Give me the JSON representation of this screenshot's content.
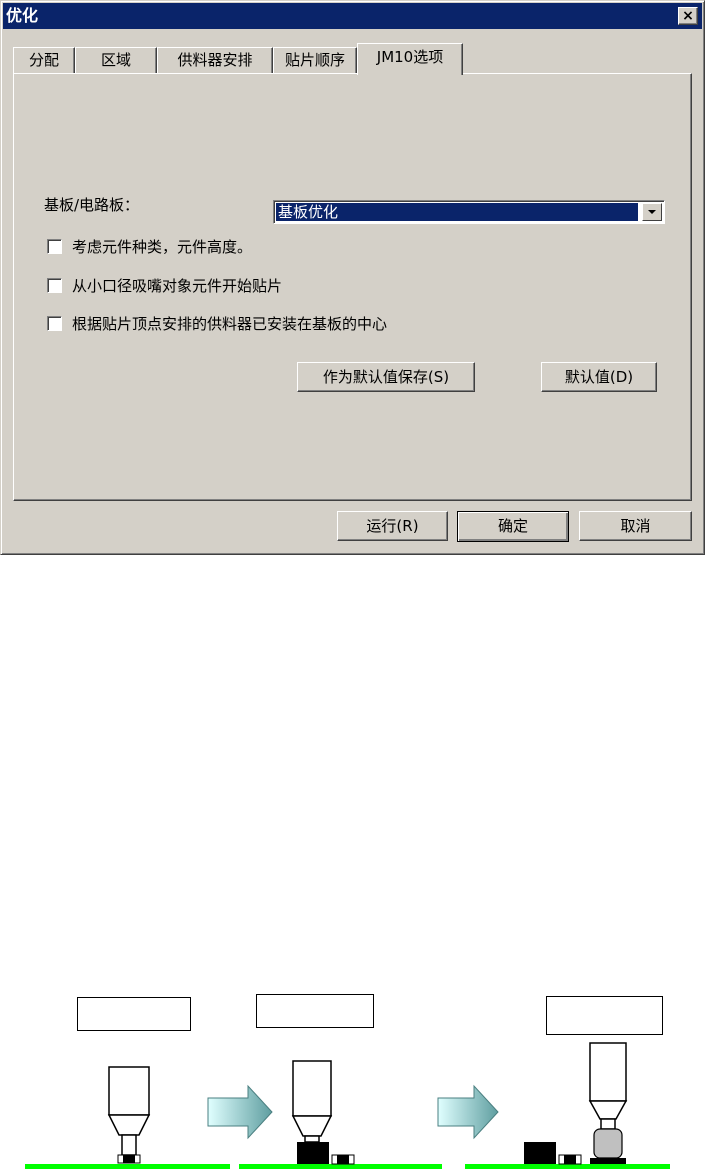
{
  "window": {
    "title": "优化",
    "close_label": "×"
  },
  "tabs": [
    {
      "label": "分配",
      "active": false
    },
    {
      "label": "区域",
      "active": false
    },
    {
      "label": "供料器安排",
      "active": false
    },
    {
      "label": "贴片顺序",
      "active": false
    },
    {
      "label": "JM10选项",
      "active": true
    }
  ],
  "panel": {
    "board_label": "基板/电路板：",
    "board_select": {
      "value": "基板优化"
    },
    "checkboxes": [
      {
        "label": "考虑元件种类，元件高度。",
        "checked": false
      },
      {
        "label": "从小口径吸嘴对象元件开始贴片",
        "checked": false
      },
      {
        "label": "根据贴片顶点安排的供料器已安装在基板的中心",
        "checked": false
      }
    ],
    "save_default_button": "作为默认值保存(S)",
    "default_button": "默认值(D)"
  },
  "footer": {
    "run_button": "运行(R)",
    "ok_button": "确定",
    "cancel_button": "取消"
  },
  "diagram": {
    "captions": [
      "",
      "",
      ""
    ],
    "colors": {
      "board": "#00ff00",
      "arrow_dark": "#5f9ea0",
      "arrow_light": "#e0ffff",
      "component": "#000000",
      "tall_component": "#c0c0c0"
    }
  }
}
